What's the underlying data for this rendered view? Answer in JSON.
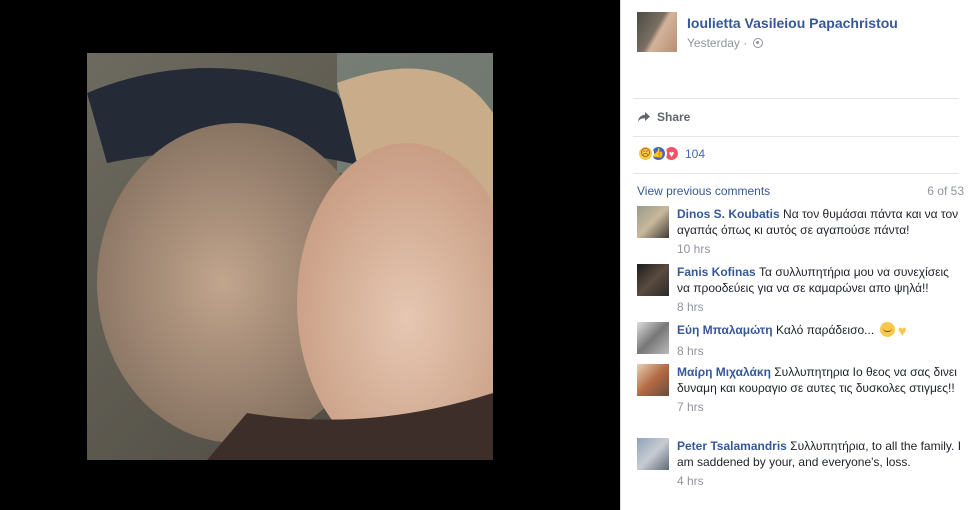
{
  "post": {
    "author": "Ioulietta Vasileiou Papachristou",
    "time": "Yesterday",
    "time_separator": "·",
    "privacy_icon": "globe-icon"
  },
  "actions": {
    "share_label": "Share",
    "share_icon": "share-arrow-icon"
  },
  "reactions": {
    "icons": [
      "sad-reaction-icon",
      "like-reaction-icon",
      "love-reaction-icon"
    ],
    "count": "104"
  },
  "comments": {
    "view_previous": "View previous comments",
    "count_label": "6 of 53",
    "items": [
      {
        "name": "Dinos S. Koubatis",
        "text": "Να τον θυμάσαι πάντα και να τον αγαπάς όπως κι αυτός σε αγαπούσε πάντα!",
        "time": "10 hrs"
      },
      {
        "name": "Fanis Kofinas",
        "text": "Τα συλλυπητήρια μου να συνεχίσεις να προοδεύεις για να σε καμαρώνει απο ψηλά!!",
        "time": "8 hrs"
      },
      {
        "name": "Εύη Μπαλαμώτη",
        "text": "Καλό παράδεισο...",
        "emojis": [
          "relieved-face-emoji",
          "yellow-heart-emoji"
        ],
        "time": "8 hrs"
      },
      {
        "name": "Μαίρη Μιχαλάκη",
        "text": "Συλλυπητηρια Ιο θεος να σας δινει δυναμη και κουραγιο σε αυτες τις δυσκολες στιγμες!!",
        "time": "7 hrs"
      },
      {
        "name": "Peter Tsalamandris",
        "text": "Συλλυπητήρια, to all the family. I am saddened by your, and everyone's, loss.",
        "time": "4 hrs"
      }
    ]
  },
  "colors": {
    "link_blue": "#365899",
    "meta_gray": "#90949c",
    "like_blue": "#4267b2",
    "love_red": "#f25268",
    "backdrop": "#000000"
  }
}
